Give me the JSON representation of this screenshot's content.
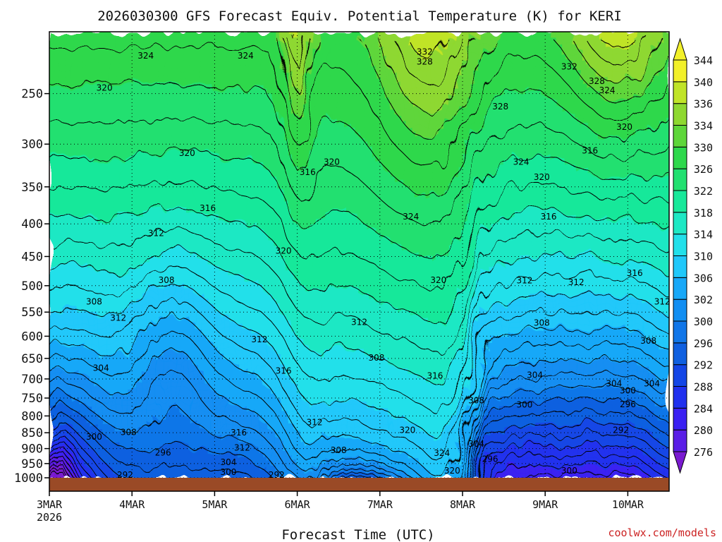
{
  "chart_data": {
    "type": "heatmap",
    "title": "2026030300 GFS Forecast Equiv. Potential Temperature (K) for KERI",
    "xlabel": "Forecast Time (UTC)",
    "ylabel": "",
    "x_tick_labels": [
      "3MAR",
      "4MAR",
      "5MAR",
      "6MAR",
      "7MAR",
      "8MAR",
      "9MAR",
      "10MAR"
    ],
    "x_tick_hours": [
      0,
      24,
      48,
      72,
      96,
      120,
      144,
      168
    ],
    "x_first_year": "2026",
    "xlim_hours": [
      0,
      180
    ],
    "y_axis_scale": "log-pressure",
    "y_tick_labels": [
      250,
      300,
      350,
      400,
      450,
      500,
      550,
      600,
      650,
      700,
      750,
      800,
      850,
      900,
      950,
      1000
    ],
    "ylim_hpa": [
      200,
      1000
    ],
    "grid": "dotted",
    "colorbar_units": "K",
    "colorbar_levels": [
      276,
      280,
      284,
      288,
      292,
      296,
      300,
      302,
      306,
      310,
      314,
      318,
      322,
      326,
      330,
      334,
      336,
      340,
      344
    ],
    "colorbar_colors": [
      "#7a1ad0",
      "#5a1ee6",
      "#3a20f2",
      "#2030ee",
      "#1446e6",
      "#1060e0",
      "#1176e8",
      "#128ef2",
      "#18a8f8",
      "#20c8fa",
      "#22e0ea",
      "#1ee8c4",
      "#18e89a",
      "#22e070",
      "#2ed84c",
      "#5ed63a",
      "#8ed830",
      "#c0e428",
      "#f2f02a"
    ],
    "contour_labels": [
      {
        "label": "324",
        "hour": 28,
        "hpa": 218
      },
      {
        "label": "324",
        "hour": 57,
        "hpa": 218
      },
      {
        "label": "332",
        "hour": 109,
        "hpa": 215
      },
      {
        "label": "328",
        "hour": 109,
        "hpa": 223
      },
      {
        "label": "332",
        "hour": 151,
        "hpa": 227
      },
      {
        "label": "328",
        "hour": 159,
        "hpa": 239
      },
      {
        "label": "324",
        "hour": 162,
        "hpa": 247
      },
      {
        "label": "320",
        "hour": 16,
        "hpa": 245
      },
      {
        "label": "328",
        "hour": 131,
        "hpa": 262
      },
      {
        "label": "320",
        "hour": 167,
        "hpa": 282
      },
      {
        "label": "316",
        "hour": 157,
        "hpa": 307
      },
      {
        "label": "320",
        "hour": 40,
        "hpa": 310
      },
      {
        "label": "320",
        "hour": 82,
        "hpa": 320
      },
      {
        "label": "316",
        "hour": 75,
        "hpa": 332
      },
      {
        "label": "324",
        "hour": 137,
        "hpa": 320
      },
      {
        "label": "320",
        "hour": 143,
        "hpa": 338
      },
      {
        "label": "316",
        "hour": 46,
        "hpa": 378
      },
      {
        "label": "324",
        "hour": 105,
        "hpa": 390
      },
      {
        "label": "316",
        "hour": 145,
        "hpa": 390
      },
      {
        "label": "312",
        "hour": 31,
        "hpa": 414
      },
      {
        "label": "320",
        "hour": 68,
        "hpa": 441
      },
      {
        "label": "308",
        "hour": 34,
        "hpa": 490
      },
      {
        "label": "320",
        "hour": 113,
        "hpa": 490
      },
      {
        "label": "312",
        "hour": 138,
        "hpa": 491
      },
      {
        "label": "312",
        "hour": 153,
        "hpa": 494
      },
      {
        "label": "316",
        "hour": 170,
        "hpa": 478
      },
      {
        "label": "308",
        "hour": 13,
        "hpa": 530
      },
      {
        "label": "312",
        "hour": 20,
        "hpa": 562
      },
      {
        "label": "312",
        "hour": 178,
        "hpa": 530
      },
      {
        "label": "312",
        "hour": 90,
        "hpa": 570
      },
      {
        "label": "308",
        "hour": 143,
        "hpa": 572
      },
      {
        "label": "312",
        "hour": 61,
        "hpa": 607
      },
      {
        "label": "308",
        "hour": 174,
        "hpa": 610
      },
      {
        "label": "304",
        "hour": 15,
        "hpa": 673
      },
      {
        "label": "308",
        "hour": 95,
        "hpa": 649
      },
      {
        "label": "316",
        "hour": 68,
        "hpa": 680
      },
      {
        "label": "316",
        "hour": 112,
        "hpa": 692
      },
      {
        "label": "304",
        "hour": 141,
        "hpa": 690
      },
      {
        "label": "304",
        "hour": 164,
        "hpa": 712
      },
      {
        "label": "300",
        "hour": 168,
        "hpa": 730
      },
      {
        "label": "304",
        "hour": 175,
        "hpa": 712
      },
      {
        "label": "308",
        "hour": 124,
        "hpa": 757
      },
      {
        "label": "300",
        "hour": 138,
        "hpa": 768
      },
      {
        "label": "296",
        "hour": 168,
        "hpa": 767
      },
      {
        "label": "312",
        "hour": 77,
        "hpa": 819
      },
      {
        "label": "308",
        "hour": 23,
        "hpa": 849
      },
      {
        "label": "316",
        "hour": 55,
        "hpa": 850
      },
      {
        "label": "320",
        "hour": 104,
        "hpa": 842
      },
      {
        "label": "292",
        "hour": 166,
        "hpa": 842
      },
      {
        "label": "300",
        "hour": 13,
        "hpa": 863
      },
      {
        "label": "312",
        "hour": 56,
        "hpa": 897
      },
      {
        "label": "308",
        "hour": 84,
        "hpa": 905
      },
      {
        "label": "304",
        "hour": 124,
        "hpa": 885
      },
      {
        "label": "324",
        "hour": 114,
        "hpa": 915
      },
      {
        "label": "296",
        "hour": 33,
        "hpa": 914
      },
      {
        "label": "304",
        "hour": 52,
        "hpa": 945
      },
      {
        "label": "296",
        "hour": 128,
        "hpa": 935
      },
      {
        "label": "300",
        "hour": 52,
        "hpa": 980
      },
      {
        "label": "320",
        "hour": 117,
        "hpa": 975
      },
      {
        "label": "300",
        "hour": 151,
        "hpa": 975
      },
      {
        "label": "292",
        "hour": 22,
        "hpa": 990
      },
      {
        "label": "292",
        "hour": 66,
        "hpa": 990
      }
    ]
  },
  "credit": "coolwx.com/models"
}
